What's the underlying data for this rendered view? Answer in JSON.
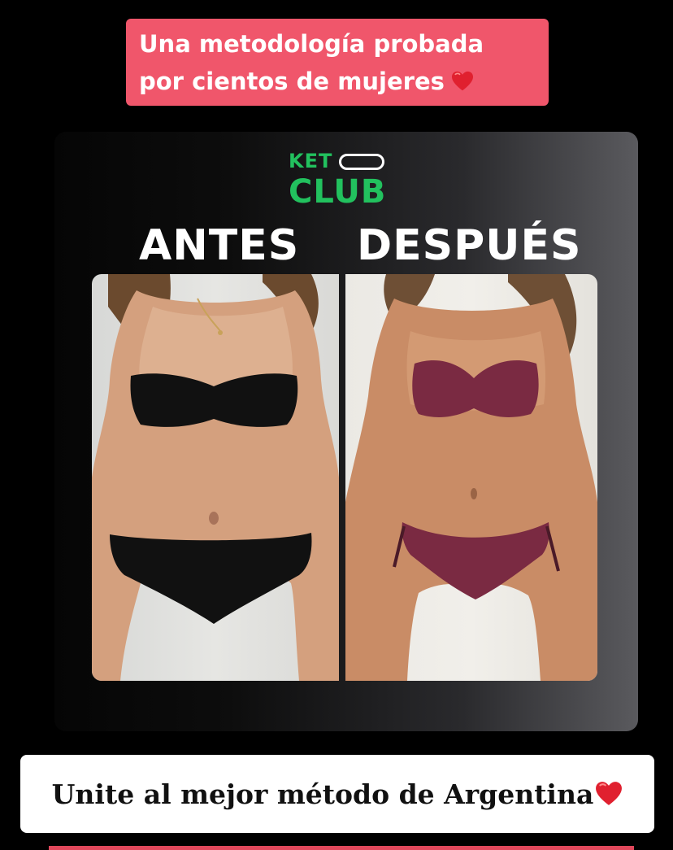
{
  "top_caption": {
    "line1": "Una metodología probada",
    "line2": "por cientos de mujeres",
    "icon": "red-heart-emoji",
    "background": "#f0566b"
  },
  "card": {
    "logo": {
      "ket": "KET",
      "club": "CLUB",
      "color": "#22c15e"
    },
    "label_before": "ANTES",
    "label_after": "DESPUÉS",
    "photos": {
      "before": {
        "description_icon": "photo-before",
        "swimsuit_color": "#111111"
      },
      "after": {
        "description_icon": "photo-after",
        "swimsuit_color": "#7a2a42"
      }
    }
  },
  "bottom_caption": {
    "text": "Unite al mejor método de Argentina",
    "icon": "red-heart-emoji"
  }
}
